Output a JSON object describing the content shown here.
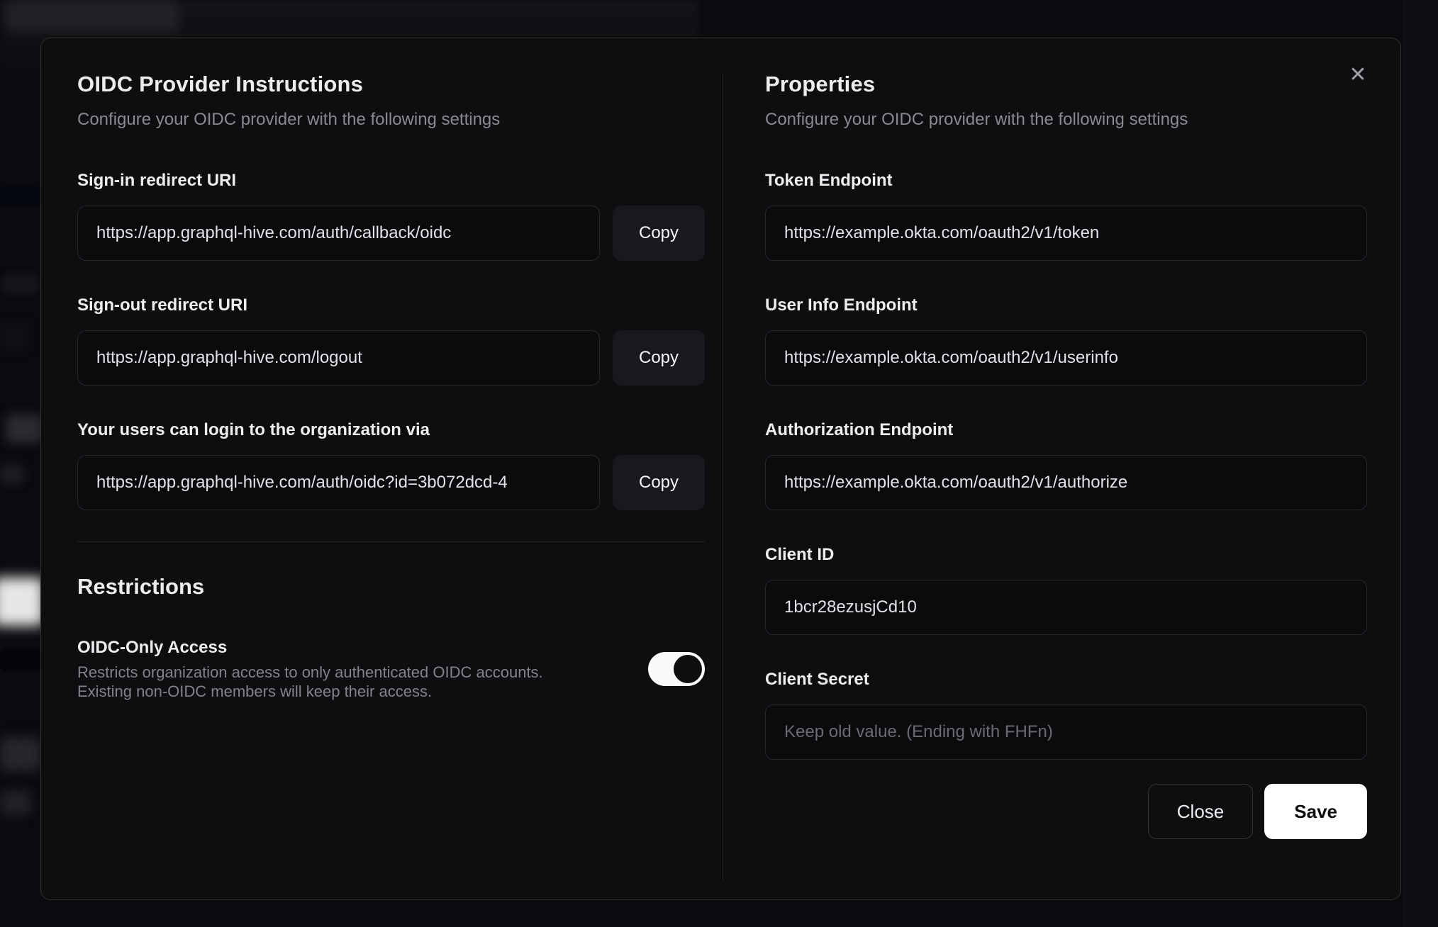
{
  "modal": {
    "close_glyph": "✕",
    "left": {
      "title": "OIDC Provider Instructions",
      "subtitle": "Configure your OIDC provider with the following settings",
      "fields": [
        {
          "label": "Sign-in redirect URI",
          "value": "https://app.graphql-hive.com/auth/callback/oidc",
          "copy_label": "Copy"
        },
        {
          "label": "Sign-out redirect URI",
          "value": "https://app.graphql-hive.com/logout",
          "copy_label": "Copy"
        },
        {
          "label": "Your users can login to the organization via",
          "value": "https://app.graphql-hive.com/auth/oidc?id=3b072dcd-4",
          "copy_label": "Copy"
        }
      ],
      "restrictions": {
        "title": "Restrictions",
        "toggle_label": "OIDC-Only Access",
        "toggle_description_line1": "Restricts organization access to only authenticated OIDC accounts.",
        "toggle_description_line2": "Existing non-OIDC members will keep their access.",
        "toggle_state": "on"
      }
    },
    "right": {
      "title": "Properties",
      "subtitle": "Configure your OIDC provider with the following settings",
      "fields": [
        {
          "label": "Token Endpoint",
          "value": "https://example.okta.com/oauth2/v1/token"
        },
        {
          "label": "User Info Endpoint",
          "value": "https://example.okta.com/oauth2/v1/userinfo"
        },
        {
          "label": "Authorization Endpoint",
          "value": "https://example.okta.com/oauth2/v1/authorize"
        },
        {
          "label": "Client ID",
          "value": "1bcr28ezusjCd10"
        },
        {
          "label": "Client Secret",
          "value": "",
          "placeholder": "Keep old value. (Ending with FHFn)"
        }
      ],
      "buttons": {
        "close": "Close",
        "save": "Save"
      }
    },
    "colors": {
      "modal_background": "#0e0e11",
      "page_background": "#0b0b0f",
      "save_button": "#ffffff",
      "toggle_on_track": "#fafafa",
      "input_border": "#28282d"
    }
  }
}
